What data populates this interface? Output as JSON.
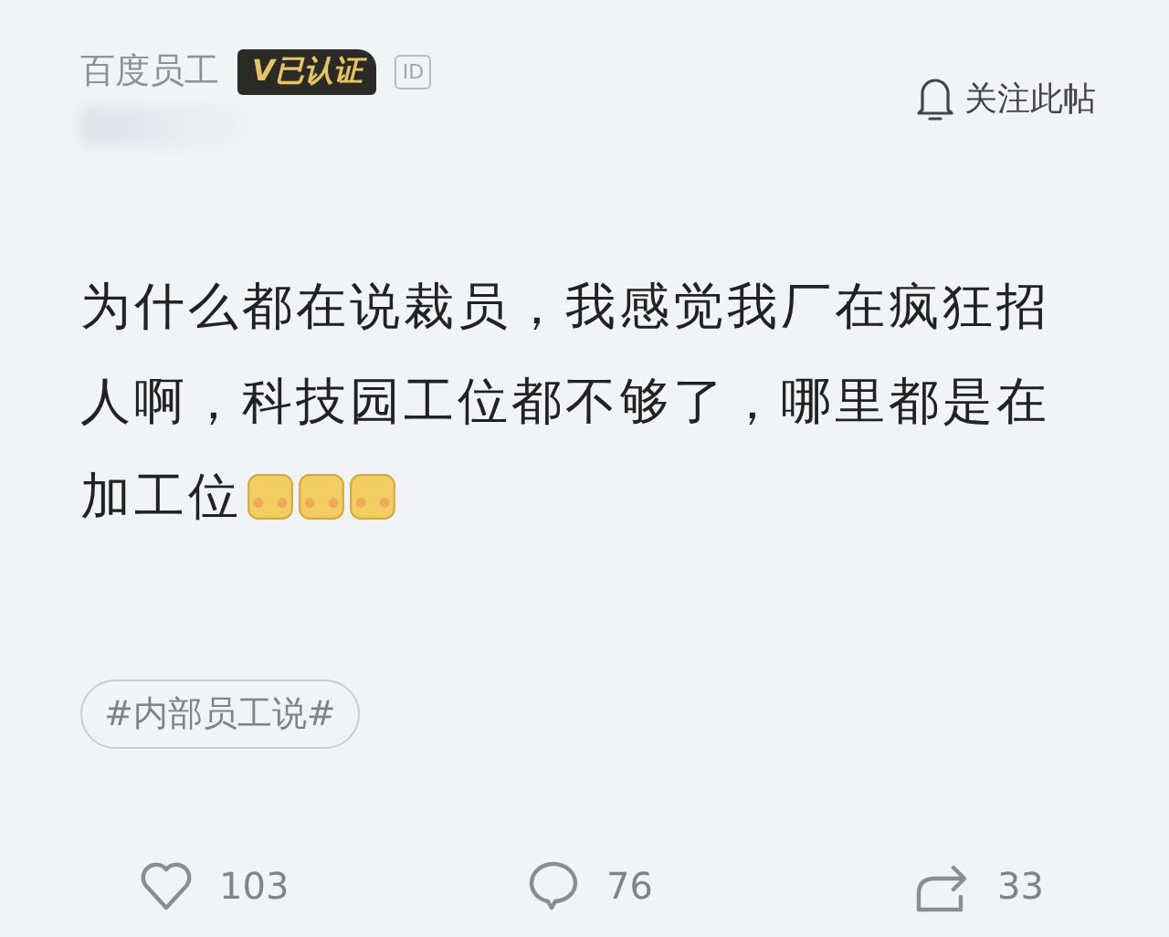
{
  "author": {
    "name": "百度员工",
    "badge": "V已认证",
    "id_tag": "ID"
  },
  "follow": {
    "label": "关注此帖"
  },
  "post": {
    "lines": [
      "为什么都在说裁员，我感觉我厂在疯狂招",
      "人啊，科技园工位都不够了，哪里都是在",
      "加工位"
    ],
    "emojis": [
      {
        "kind": "emoji"
      },
      {
        "kind": "emoji"
      },
      {
        "kind": "emoji"
      }
    ]
  },
  "tag": "#内部员工说#",
  "actions": [
    {
      "kind": "like",
      "count": "103"
    },
    {
      "kind": "comment",
      "count": "76"
    },
    {
      "kind": "share",
      "count": "33"
    }
  ]
}
